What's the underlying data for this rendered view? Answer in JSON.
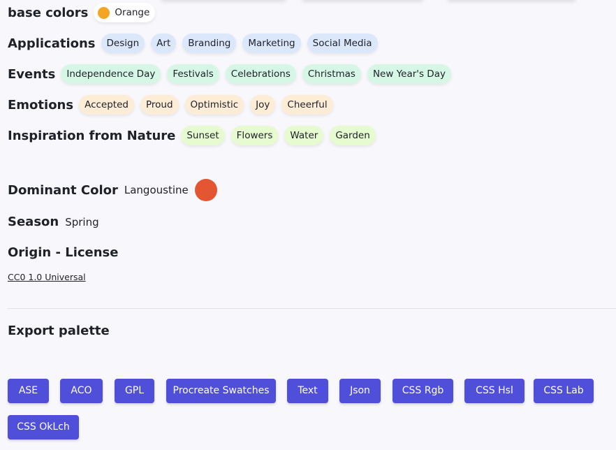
{
  "base_colors": {
    "title": "base colors",
    "chip": {
      "label": "Orange",
      "color": "#f5a524"
    }
  },
  "applications": {
    "title": "Applications",
    "tags": [
      "Design",
      "Art",
      "Branding",
      "Marketing",
      "Social Media"
    ]
  },
  "events": {
    "title": "Events",
    "tags": [
      "Independence Day",
      "Festivals",
      "Celebrations",
      "Christmas",
      "New Year's Day"
    ]
  },
  "emotions": {
    "title": "Emotions",
    "tags": [
      "Accepted",
      "Proud",
      "Optimistic",
      "Joy",
      "Cheerful"
    ]
  },
  "nature": {
    "title": "Inspiration from Nature",
    "tags": [
      "Sunset",
      "Flowers",
      "Water",
      "Garden"
    ]
  },
  "dominant": {
    "title": "Dominant Color",
    "name": "Langoustine",
    "color": "#e45632"
  },
  "season": {
    "title": "Season",
    "value": "Spring"
  },
  "origin": {
    "title": "Origin - License",
    "license": "CC0 1.0 Universal"
  },
  "export": {
    "title": "Export palette",
    "buttons": [
      "ASE",
      "ACO",
      "GPL",
      "Procreate Swatches",
      "Text",
      "Json",
      "CSS Rgb",
      "CSS Hsl",
      "CSS Lab",
      "CSS OkLch"
    ]
  },
  "colors": {
    "button": "#4f4fd9",
    "tag_blue": "#dbe8fb",
    "tag_green": "#d6f7e6",
    "tag_orange": "#fdecd6",
    "tag_lime": "#e6fbd0"
  }
}
